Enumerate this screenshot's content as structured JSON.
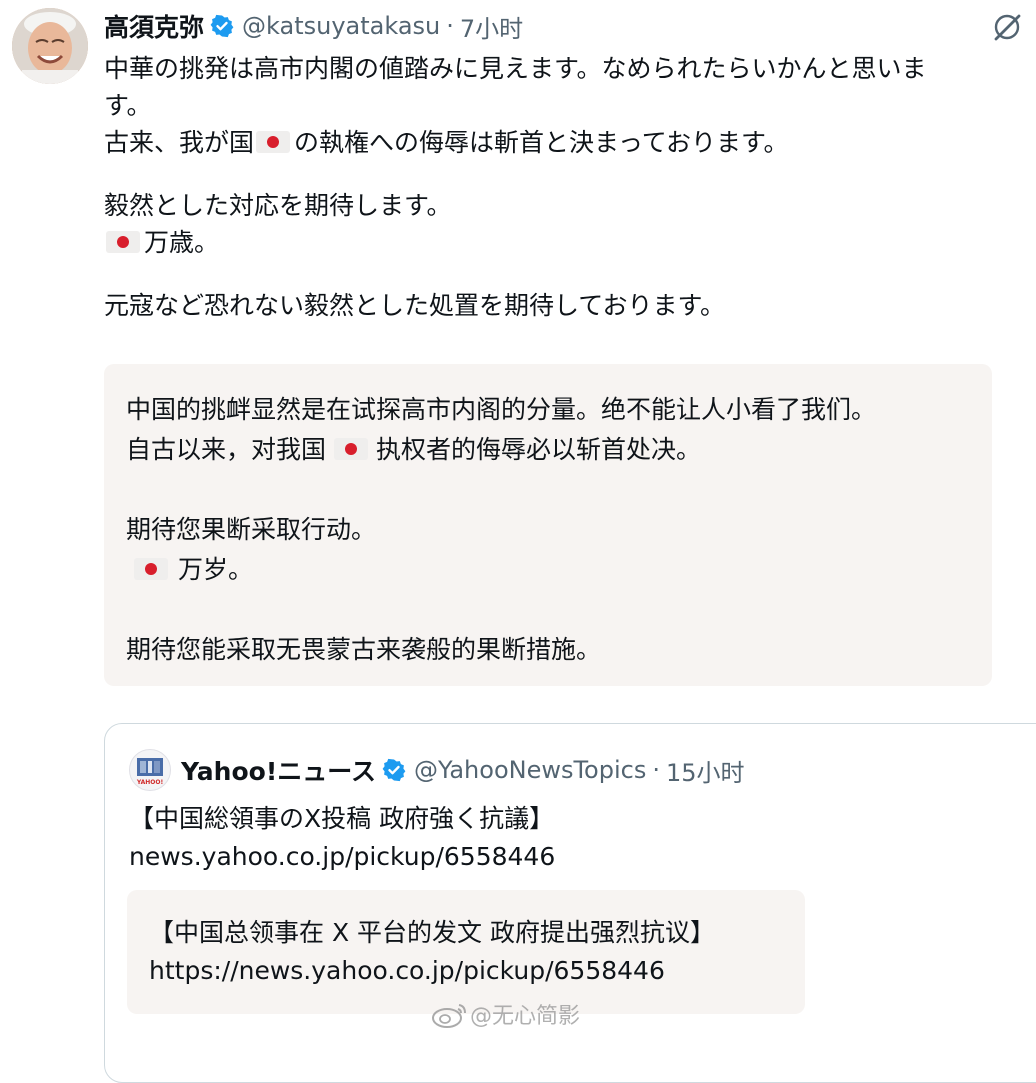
{
  "tweet": {
    "author_name": "高須克弥",
    "handle": "@katsuyatakasu",
    "separator": "·",
    "time": "7小时",
    "verified_icon": "verified-badge-icon",
    "menu_icon": "grok-icon",
    "lines": {
      "l1": "中華の挑発は高市内閣の値踏みに見えます。なめられたらいかんと思いま",
      "l2": "す。",
      "l3a": "古来、我が国",
      "l3b": "の執権への侮辱は斬首と決まっております。",
      "l4": "毅然とした対応を期待します。",
      "l5": "万歳。",
      "l6": "元寇など恐れない毅然とした処置を期待しております。"
    }
  },
  "translation": {
    "l1": "中国的挑衅显然是在试探高市内阁的分量。绝不能让人小看了我们。",
    "l2a": "自古以来，对我国",
    "l2b": "执权者的侮辱必以斩首处决。",
    "l3": "期待您果断采取行动。",
    "l4": "万岁。",
    "l5": "期待您能采取无畏蒙古来袭般的果断措施。"
  },
  "quote": {
    "author_name": "Yahoo!ニュース",
    "avatar_text": "YAHOO!",
    "handle": "@YahooNewsTopics",
    "separator": "·",
    "time": "15小时",
    "line1": "【中国総領事のX投稿 政府強く抗議】",
    "line2": "news.yahoo.co.jp/pickup/6558446",
    "translation_line1": "【中国总领事在 X 平台的发文 政府提出强烈抗议】",
    "translation_line2": "https://news.yahoo.co.jp/pickup/6558446"
  },
  "watermark": {
    "text": "@无心简影",
    "icon": "weibo-icon"
  },
  "colors": {
    "verified": "#1d9bf0",
    "muted": "#536471",
    "translation_bg": "#f7f4f2",
    "flag_red": "#d81e2c"
  }
}
